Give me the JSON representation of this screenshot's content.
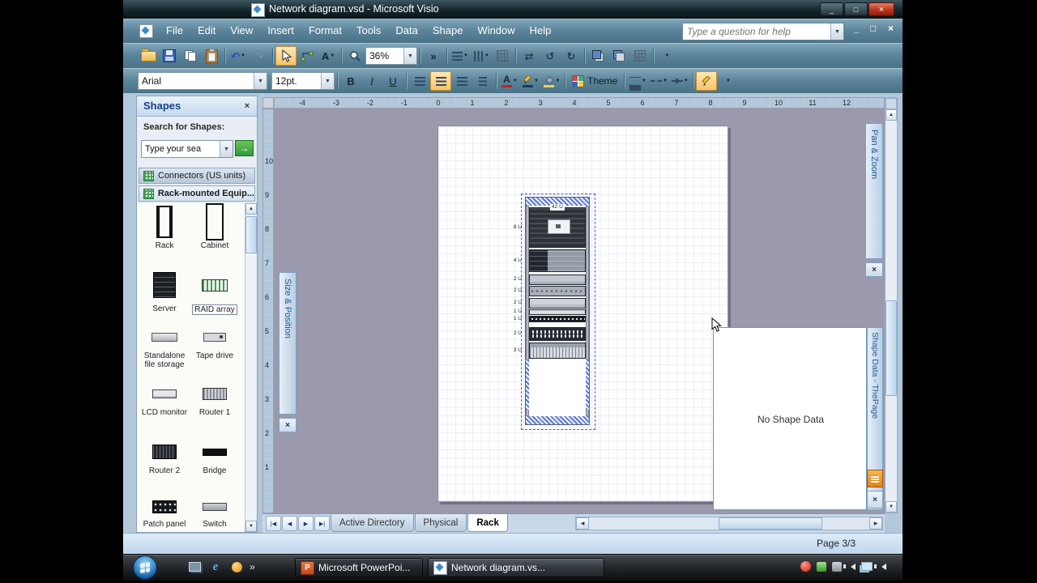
{
  "window": {
    "title": "Network diagram.vsd - Microsoft Visio"
  },
  "menu_bar": {
    "items": [
      "File",
      "Edit",
      "View",
      "Insert",
      "Format",
      "Tools",
      "Data",
      "Shape",
      "Window",
      "Help"
    ],
    "help_placeholder": "Type a question for help"
  },
  "standard_toolbar": {
    "zoom_value": "36%"
  },
  "formatting_toolbar": {
    "font_name": "Arial",
    "font_size": "12pt.",
    "bold_label": "B",
    "italic_label": "I",
    "underline_label": "U",
    "font_color_letter": "A",
    "text_tool_letter": "A",
    "theme_label": "Theme"
  },
  "shapes_panel": {
    "title": "Shapes",
    "search_label": "Search for Shapes:",
    "search_value": "Type your sea",
    "stencils": [
      {
        "label": "Connectors (US units)"
      },
      {
        "label": "Rack-mounted Equip..."
      }
    ],
    "shapes": [
      {
        "label": "Rack"
      },
      {
        "label": "Cabinet"
      },
      {
        "label": "Server"
      },
      {
        "label": "RAID array"
      },
      {
        "label": "Standalone file storage"
      },
      {
        "label": "Tape drive"
      },
      {
        "label": "LCD monitor"
      },
      {
        "label": "Router 1"
      },
      {
        "label": "Router 2"
      },
      {
        "label": "Bridge"
      },
      {
        "label": "Patch panel"
      },
      {
        "label": "Switch"
      }
    ]
  },
  "rulers": {
    "horizontal": [
      "-4",
      "-3",
      "-2",
      "-1",
      "0",
      "1",
      "2",
      "3",
      "4",
      "5",
      "6",
      "7",
      "8",
      "9",
      "10",
      "11",
      "12"
    ],
    "vertical": [
      "10",
      "9",
      "8",
      "7",
      "6",
      "5",
      "4",
      "3",
      "2",
      "1"
    ]
  },
  "drawing": {
    "rack_total_label": "42 U",
    "unit_labels": [
      "8 U",
      "4 U",
      "2 U",
      "2 U",
      "2 U",
      "1 U",
      "1 U",
      "2 U",
      "3 U"
    ]
  },
  "task_panes": {
    "size_position_title": "Size & Position",
    "pan_zoom_title": "Pan & Zoom",
    "shape_data_title": "Shape Data - ThePage",
    "shape_data_message": "No Shape Data"
  },
  "page_tabs": {
    "tabs": [
      "Active Directory",
      "Physical",
      "Rack"
    ]
  },
  "status_bar": {
    "page_indicator": "Page 3/3"
  },
  "taskbar": {
    "buttons": [
      {
        "label": "Microsoft PowerPoi..."
      },
      {
        "label": "Network diagram.vs..."
      }
    ]
  },
  "colors": {
    "selection_accent": "#4a5fd0",
    "canvas_background": "#9b99ad",
    "close_button_red": "#c03a20",
    "search_go_green": "#3fae49",
    "powerpoint_orange": "#d2571e"
  },
  "icons": {
    "close": "×",
    "dropdown": "▼",
    "minimize": "_",
    "restore": "□",
    "undo": "↶",
    "redo": "↷",
    "chevron": "»",
    "go": "→",
    "up": "▲",
    "down": "▼",
    "left": "◀",
    "right": "▶",
    "nav_first": "|◀",
    "nav_last": "▶|",
    "ppt_letter": "P",
    "ie_letter": "e"
  }
}
